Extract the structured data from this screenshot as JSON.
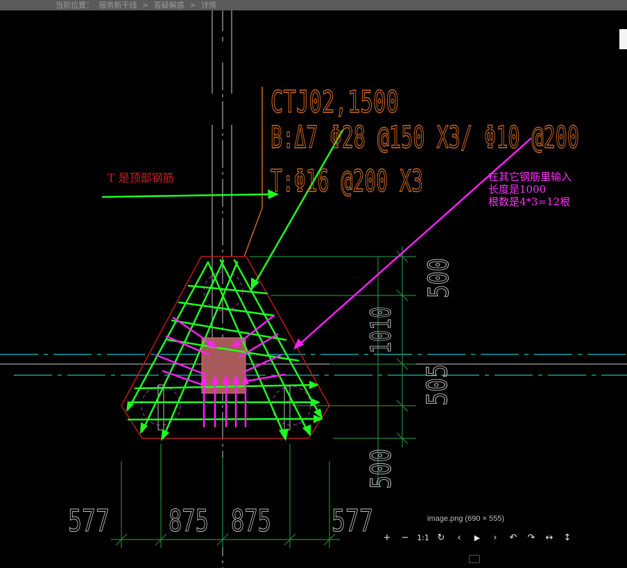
{
  "breadcrumb": {
    "prefix": "当前位置：",
    "items": [
      "服务新干线",
      "答疑解惑",
      "详情"
    ],
    "separator": ">"
  },
  "drawing": {
    "label_line1": "CTJ02,1500",
    "label_line2": "B:Δ7 Φ28 @150 X3/ Φ10 @200",
    "label_line3": "T:Φ16 @200 X3",
    "dim_right_top": "500",
    "dim_right_total": "1010",
    "dim_right_mid": "505",
    "dim_right_bottom": "500",
    "dim_bottom": [
      "577",
      "875",
      "875",
      "577"
    ]
  },
  "annotations": {
    "red_note": "T  是顶部钢筋",
    "magenta_note": [
      "在其它钢筋里输入",
      "长度是1000",
      "根数是4*3=12根"
    ]
  },
  "viewer": {
    "caption": "image.png (690 × 555)",
    "tools": [
      {
        "name": "zoom-in",
        "glyph": "+"
      },
      {
        "name": "zoom-out",
        "glyph": "−"
      },
      {
        "name": "actual-size",
        "glyph": "1:1"
      },
      {
        "name": "rotate",
        "glyph": "↻"
      },
      {
        "name": "prev",
        "glyph": "‹"
      },
      {
        "name": "play",
        "glyph": "▶"
      },
      {
        "name": "next",
        "glyph": "›"
      },
      {
        "name": "rotate-left",
        "glyph": "↶"
      },
      {
        "name": "rotate-right",
        "glyph": "↷"
      },
      {
        "name": "flip-horizontal",
        "glyph": "↔"
      },
      {
        "name": "flip-vertical",
        "glyph": "↕"
      }
    ]
  },
  "colors": {
    "rebar_green": "#20ff20",
    "arrow_magenta": "#ff20ff",
    "outline_red": "#c01818",
    "label_orange": "#d2691e",
    "dimension_green": "#1f8a3a",
    "center_cyan": "#0aa6a6"
  }
}
